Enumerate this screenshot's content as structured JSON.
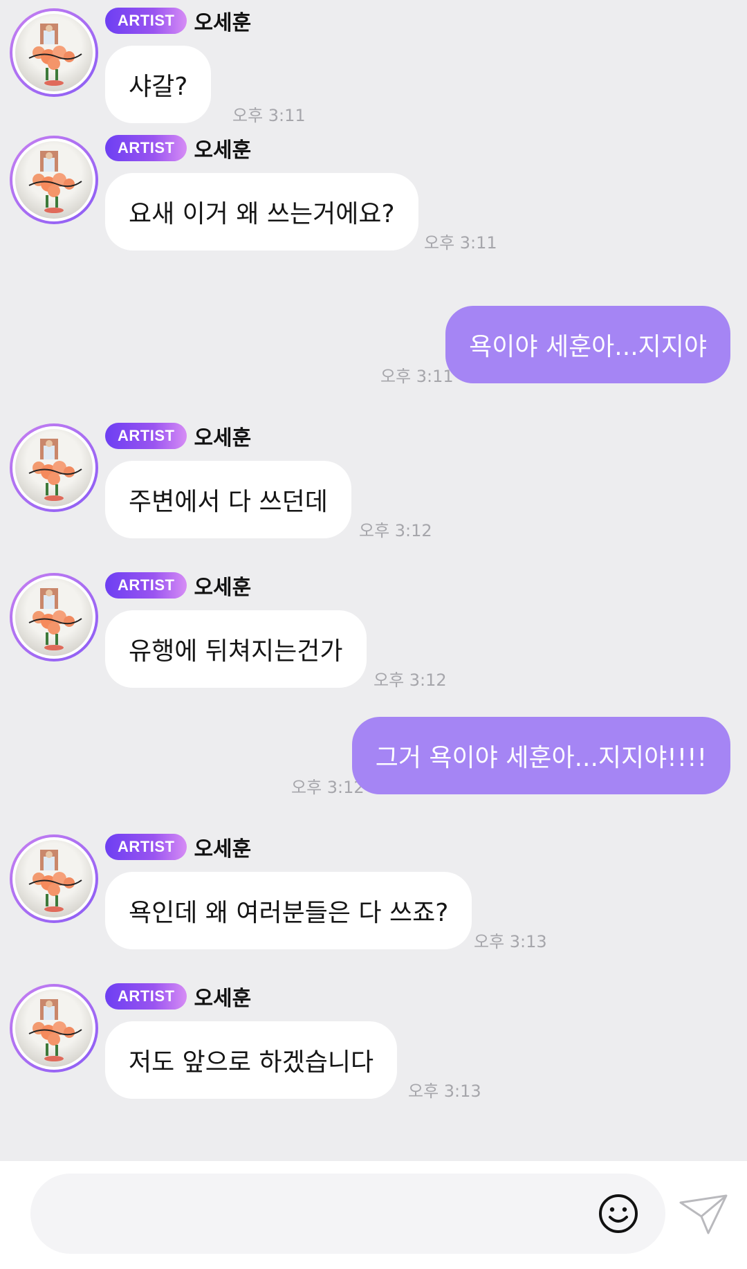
{
  "messages": [
    {
      "type": "in",
      "badge": "ARTIST",
      "sender": "오세훈",
      "text": "샤갈?",
      "time": "오후 3:11"
    },
    {
      "type": "in",
      "badge": "ARTIST",
      "sender": "오세훈",
      "text": "요새 이거 왜 쓰는거에요?",
      "time": "오후 3:11"
    },
    {
      "type": "out",
      "text": "욕이야 세훈아...지지야",
      "time": "오후 3:11"
    },
    {
      "type": "in",
      "badge": "ARTIST",
      "sender": "오세훈",
      "text": "주변에서 다 쓰던데",
      "time": "오후 3:12"
    },
    {
      "type": "in",
      "badge": "ARTIST",
      "sender": "오세훈",
      "text": "유행에 뒤쳐지는건가",
      "time": "오후 3:12"
    },
    {
      "type": "out",
      "text": "그거 욕이야 세훈아...지지야!!!!",
      "time": "오후 3:12"
    },
    {
      "type": "in",
      "badge": "ARTIST",
      "sender": "오세훈",
      "text": "욕인데 왜 여러분들은 다 쓰죠?",
      "time": "오후 3:13"
    },
    {
      "type": "in",
      "badge": "ARTIST",
      "sender": "오세훈",
      "text": "저도 앞으로 하겠습니다",
      "time": "오후 3:13"
    }
  ],
  "composer": {
    "placeholder": "",
    "emoji_icon": "smiley-icon",
    "send_icon": "paper-plane-icon"
  },
  "colors": {
    "background": "#ededef",
    "incoming_bubble": "#ffffff",
    "outgoing_bubble": "#a585f4",
    "badge_gradient_start": "#6d3ff2",
    "badge_gradient_end": "#d68cf5",
    "timestamp": "#a6a6ab"
  }
}
